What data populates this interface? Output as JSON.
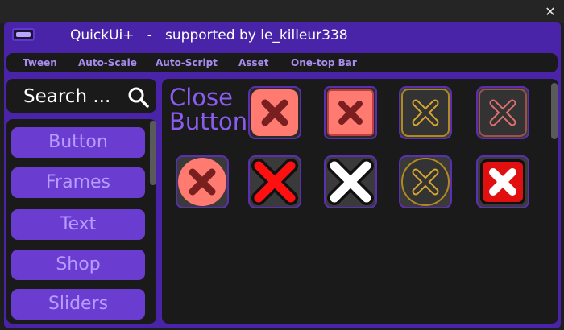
{
  "window": {
    "title": "QuickUi+   -   supported by le_killeur338"
  },
  "menu": [
    "Tween",
    "Auto-Scale",
    "Auto-Script",
    "Asset",
    "One-top Bar"
  ],
  "search": {
    "text": "Search ..."
  },
  "categories": [
    "Button",
    "Frames",
    "Text",
    "Shop",
    "Sliders"
  ],
  "content": {
    "label": "Close\nButton."
  },
  "colors": {
    "window_bg": "#4a24a8",
    "panel_bg": "#1a1a1a",
    "accent": "#6b3cd0",
    "accent_text": "#b79cff"
  },
  "close_buttons": [
    {
      "name": "close-icon-salmon-rounded"
    },
    {
      "name": "close-icon-salmon-square"
    },
    {
      "name": "close-icon-gold-outline"
    },
    {
      "name": "close-icon-pink-outline"
    },
    {
      "name": "close-icon-salmon-circle"
    },
    {
      "name": "close-icon-red-bold"
    },
    {
      "name": "close-icon-white-bold"
    },
    {
      "name": "close-icon-gold-circle"
    },
    {
      "name": "close-icon-red-white"
    }
  ]
}
